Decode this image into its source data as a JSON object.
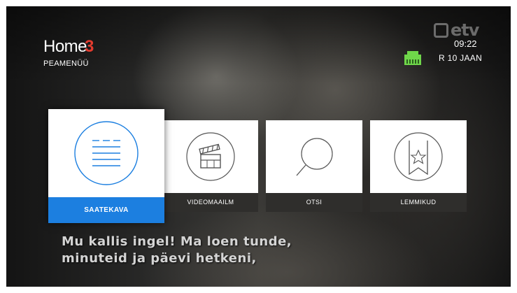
{
  "brand": {
    "name": "Home",
    "accent": "3",
    "subtitle": "PEAMENÜÜ"
  },
  "status": {
    "channel_logo": "etv",
    "time": "09:22",
    "date": "R 10 JAAN",
    "network_icon": "ethernet-port-icon"
  },
  "menu": {
    "items": [
      {
        "label": "SAATEKAVA",
        "icon": "list-icon",
        "focused": true
      },
      {
        "label": "VIDEOMAAILM",
        "icon": "clapperboard-icon",
        "focused": false
      },
      {
        "label": "OTSI",
        "icon": "search-icon",
        "focused": false
      },
      {
        "label": "LEMMIKUD",
        "icon": "bookmark-star-icon",
        "focused": false
      }
    ]
  },
  "subtitles": {
    "line1": "Mu kallis ingel! Ma loen tunde,",
    "line2": "minuteid ja päevi hetkeni,"
  },
  "colors": {
    "accent": "#1c7fe0",
    "brand_accent": "#e23b2e",
    "network": "#6fd64a"
  }
}
